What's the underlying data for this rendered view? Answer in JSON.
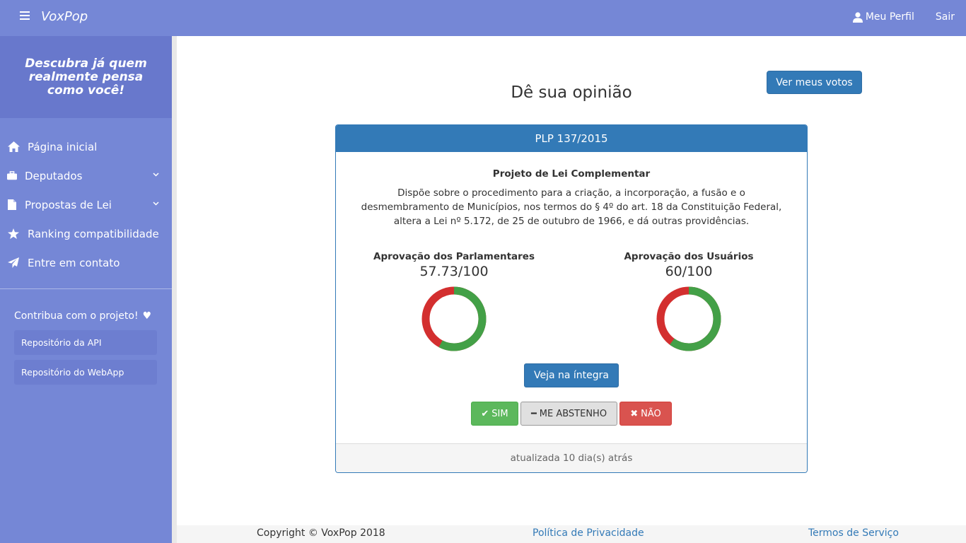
{
  "header": {
    "brand": "VoxPop",
    "profile_label": "Meu Perfil",
    "logout_label": "Sair"
  },
  "sidebar": {
    "tagline": "Descubra já quem realmente pensa como você!",
    "items": [
      {
        "label": "Página inicial",
        "icon": "home-icon"
      },
      {
        "label": "Deputados",
        "icon": "briefcase-icon"
      },
      {
        "label": "Propostas de Lei",
        "icon": "file-icon"
      },
      {
        "label": "Ranking compatibilidade",
        "icon": "star-icon"
      },
      {
        "label": "Entre em contato",
        "icon": "send-icon"
      }
    ],
    "contribute_label": "Contribua com o projeto!",
    "repos": [
      {
        "label": "Repositório da API"
      },
      {
        "label": "Repositório do WebApp"
      }
    ]
  },
  "main": {
    "title": "Dê sua opinião",
    "my_votes_label": "Ver meus votos",
    "proposal": {
      "code": "PLP 137/2015",
      "type": "Projeto de Lei Complementar",
      "description": "Dispõe sobre o procedimento para a criação, a incorporação, a fusão e o desmembramento de Municípios, nos termos do § 4º do art. 18 da Constituição Federal, altera a Lei nº 5.172, de 25 de outubro de 1966, e dá outras providências.",
      "parliament": {
        "label": "Aprovação dos Parlamentares",
        "score_text": "57.73/100",
        "value": 57.73
      },
      "users": {
        "label": "Aprovação dos Usuários",
        "score_text": "60/100",
        "value": 60
      },
      "full_text_label": "Veja na íntegra",
      "vote_yes": "SIM",
      "vote_abstain": "ME ABSTENHO",
      "vote_no": "NÃO",
      "updated": "atualizada 10 dia(s) atrás"
    }
  },
  "colors": {
    "approve": "#43a047",
    "reject": "#d32f2f",
    "primary": "#337ab7",
    "sidebar": "#7587d6"
  },
  "footer": {
    "copyright": "Copyright © VoxPop 2018",
    "privacy": "Política de Privacidade",
    "terms": "Termos de Serviço"
  }
}
